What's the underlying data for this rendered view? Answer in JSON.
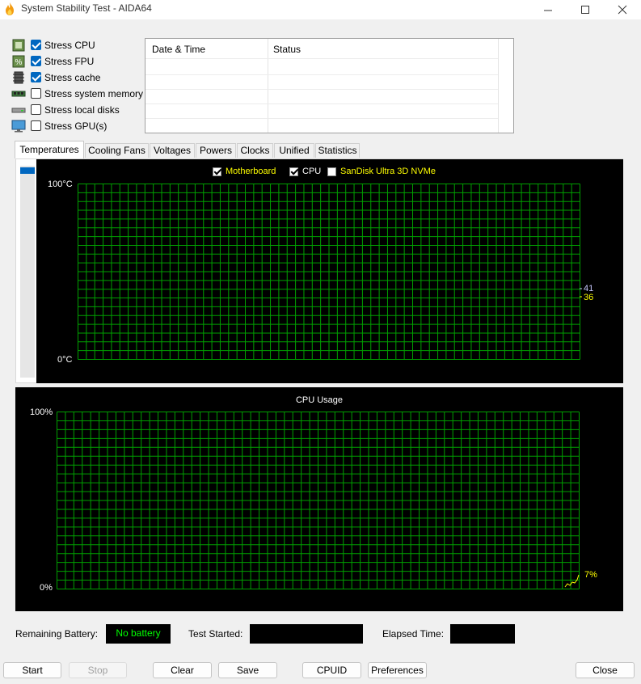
{
  "window": {
    "title": "System Stability Test - AIDA64",
    "controls": [
      "minimize-icon",
      "maximize-icon",
      "close-icon"
    ]
  },
  "stress_options": [
    {
      "label": "Stress CPU",
      "checked": true,
      "icon": "cpu-chip-icon"
    },
    {
      "label": "Stress FPU",
      "checked": true,
      "icon": "fpu-chip-icon"
    },
    {
      "label": "Stress cache",
      "checked": true,
      "icon": "cache-chip-icon"
    },
    {
      "label": "Stress system memory",
      "checked": false,
      "icon": "memory-module-icon"
    },
    {
      "label": "Stress local disks",
      "checked": false,
      "icon": "hard-disk-icon"
    },
    {
      "label": "Stress GPU(s)",
      "checked": false,
      "icon": "monitor-gpu-icon"
    }
  ],
  "status_table": {
    "columns": [
      "Date & Time",
      "Status"
    ],
    "rows": []
  },
  "tabs": [
    {
      "label": "Temperatures",
      "active": true
    },
    {
      "label": "Cooling Fans",
      "active": false
    },
    {
      "label": "Voltages",
      "active": false
    },
    {
      "label": "Powers",
      "active": false
    },
    {
      "label": "Clocks",
      "active": false
    },
    {
      "label": "Unified",
      "active": false
    },
    {
      "label": "Statistics",
      "active": false
    }
  ],
  "temperature_graph": {
    "legend": [
      {
        "label": "Motherboard",
        "checked": true,
        "color": "#ffff00"
      },
      {
        "label": "CPU",
        "checked": true,
        "color": "#ffffff"
      },
      {
        "label": "SanDisk Ultra 3D NVMe",
        "checked": false,
        "color": "#ffff00"
      }
    ],
    "y_max_label": "100°C",
    "y_min_label": "0°C",
    "current_values": [
      {
        "value": "41",
        "color": "#c8c8ff"
      },
      {
        "value": "36",
        "color": "#ffff00"
      }
    ]
  },
  "cpu_graph": {
    "title": "CPU Usage",
    "y_max_label": "100%",
    "y_min_label": "0%",
    "current_value": "7%",
    "value_color": "#ffff00"
  },
  "info": {
    "remaining_battery_label": "Remaining Battery:",
    "remaining_battery_value": "No battery",
    "test_started_label": "Test Started:",
    "test_started_value": "",
    "elapsed_time_label": "Elapsed Time:",
    "elapsed_time_value": ""
  },
  "buttons": {
    "start": "Start",
    "stop": "Stop",
    "clear": "Clear",
    "save": "Save",
    "cpuid": "CPUID",
    "preferences": "Preferences",
    "close": "Close"
  },
  "colors": {
    "grid": "#00a000",
    "accent": "#0067c0",
    "battery_text": "#00ff00"
  }
}
